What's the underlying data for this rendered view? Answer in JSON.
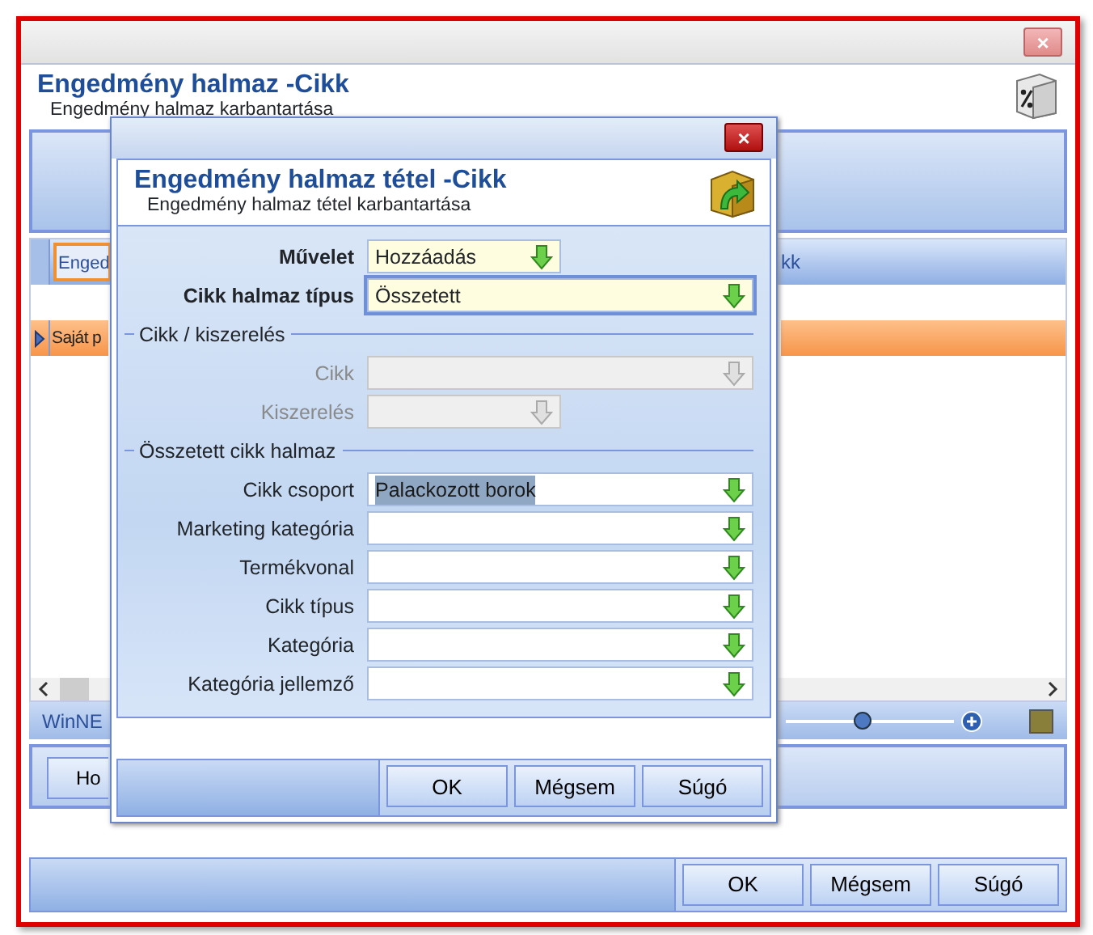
{
  "window": {
    "title": "Engedmény halmaz -Cikk",
    "subtitle": "Engedmény halmaz karbantartása",
    "close_glyph": "×"
  },
  "grid": {
    "header_cell": "Enged",
    "header_cell_right": "kk",
    "rows": [
      {
        "text": "Saját p",
        "selected": true
      }
    ]
  },
  "status_bar": {
    "text": "WinNE",
    "zoom": {
      "level": 0.45
    }
  },
  "panel_button": "Ho",
  "buttons": [
    "OK",
    "Mégsem",
    "Súgó"
  ],
  "dialog": {
    "title": "Engedmény halmaz tétel -Cikk",
    "subtitle": "Engedmény halmaz tétel karbantartása",
    "close_glyph": "×",
    "items": [
      {
        "kind": "field",
        "label": "Művelet",
        "required": true,
        "value": "Hozzáadás",
        "disabled": false,
        "focused": false,
        "wide": false,
        "highlighted": false
      },
      {
        "kind": "field",
        "label": "Cikk halmaz típus",
        "required": true,
        "value": "Összetett",
        "disabled": false,
        "focused": true,
        "wide": true,
        "highlighted": false
      },
      {
        "kind": "section",
        "label": "Cikk / kiszerelés"
      },
      {
        "kind": "field",
        "label": "Cikk",
        "required": false,
        "value": "",
        "disabled": true,
        "focused": false,
        "wide": true,
        "highlighted": false
      },
      {
        "kind": "field",
        "label": "Kiszerelés",
        "required": false,
        "value": "",
        "disabled": true,
        "focused": false,
        "wide": false,
        "highlighted": false
      },
      {
        "kind": "section",
        "label": "Összetett cikk halmaz"
      },
      {
        "kind": "field",
        "label": "Cikk csoport",
        "required": false,
        "value": "Palackozott borok",
        "disabled": false,
        "focused": false,
        "wide": true,
        "highlighted": true
      },
      {
        "kind": "field",
        "label": "Marketing kategória",
        "required": false,
        "value": "",
        "disabled": false,
        "focused": false,
        "wide": true,
        "highlighted": false
      },
      {
        "kind": "field",
        "label": "Termékvonal",
        "required": false,
        "value": "",
        "disabled": false,
        "focused": false,
        "wide": true,
        "highlighted": false
      },
      {
        "kind": "field",
        "label": "Cikk típus",
        "required": false,
        "value": "",
        "disabled": false,
        "focused": false,
        "wide": true,
        "highlighted": false
      },
      {
        "kind": "field",
        "label": "Kategória",
        "required": false,
        "value": "",
        "disabled": false,
        "focused": false,
        "wide": true,
        "highlighted": false
      },
      {
        "kind": "field",
        "label": "Kategória jellemző",
        "required": false,
        "value": "",
        "disabled": false,
        "focused": false,
        "wide": true,
        "highlighted": false
      }
    ],
    "buttons": [
      "OK",
      "Mégsem",
      "Súgó"
    ]
  }
}
